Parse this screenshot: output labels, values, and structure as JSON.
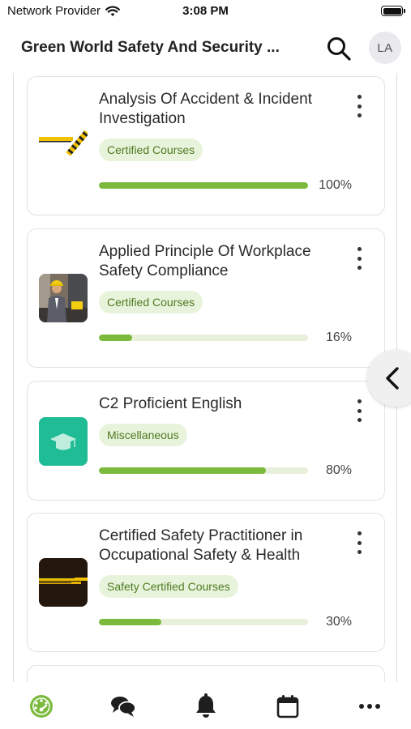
{
  "status_bar": {
    "carrier": "Network Provider",
    "time": "3:08 PM"
  },
  "header": {
    "title": "Green World Safety And Security ...",
    "avatar_initials": "LA"
  },
  "colors": {
    "accent": "#7cba3d",
    "chip_bg": "#e8f3dc",
    "chip_text": "#4e7a1f",
    "track": "#e8f0dc"
  },
  "courses": [
    {
      "title": "Analysis Of Accident & Incident Investigation",
      "category": "Certified Courses",
      "progress": 100,
      "progress_label": "100%",
      "thumbnail": "caution-tape-thumbnail"
    },
    {
      "title": "Applied Principle Of Workplace Safety Compliance",
      "category": "Certified Courses",
      "progress": 16,
      "progress_label": "16%",
      "thumbnail": "safety-worker-photo-thumbnail"
    },
    {
      "title": "C2 Proficient English",
      "category": "Miscellaneous",
      "progress": 80,
      "progress_label": "80%",
      "thumbnail": "graduation-cap-icon"
    },
    {
      "title": "Certified Safety Practitioner in Occupational Safety & Health",
      "category": "Safety Certified Courses",
      "progress": 30,
      "progress_label": "30%",
      "thumbnail": "dark-banner-thumbnail"
    }
  ],
  "tabbar": {
    "items": [
      "dashboard-icon",
      "chat-icon",
      "bell-icon",
      "calendar-icon",
      "more-icon"
    ],
    "active": "dashboard-icon"
  }
}
